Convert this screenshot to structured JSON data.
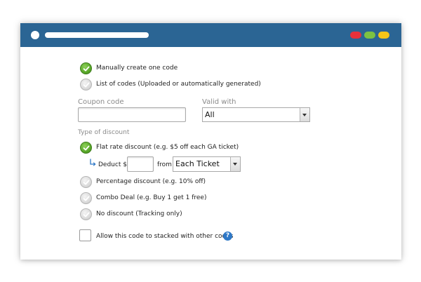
{
  "window": {
    "titlebar_controls": [
      "close-dot",
      "title-placeholder-bar"
    ],
    "traffic_lights": [
      "#e8313a",
      "#7dc242",
      "#f5c518"
    ],
    "titlebar_color": "#2b6594"
  },
  "code_source": {
    "options": [
      {
        "label": "Manually create one code",
        "selected": true
      },
      {
        "label": "List of codes (Uploaded or automatically generated)",
        "selected": false
      }
    ]
  },
  "coupon_code": {
    "label": "Coupon code",
    "value": ""
  },
  "valid_with": {
    "label": "Valid with",
    "value": "All"
  },
  "discount": {
    "label": "Type of discount",
    "options": [
      {
        "label": "Flat rate discount (e.g. $5 off each GA ticket)",
        "selected": true
      },
      {
        "label": "Percentage discount (e.g. 10% off)",
        "selected": false
      },
      {
        "label": "Combo Deal (e.g. Buy 1 get 1 free)",
        "selected": false
      },
      {
        "label": "No discount (Tracking only)",
        "selected": false
      }
    ],
    "deduct": {
      "label": "Deduct $",
      "value": "",
      "from_label": "from",
      "from_value": "Each Ticket"
    }
  },
  "stacking": {
    "label": "Allow this code to stacked with other codes",
    "checked": false,
    "help_icon": "?"
  },
  "colors": {
    "accent_green": "#5aa82a",
    "help_blue": "#2e78c7"
  }
}
